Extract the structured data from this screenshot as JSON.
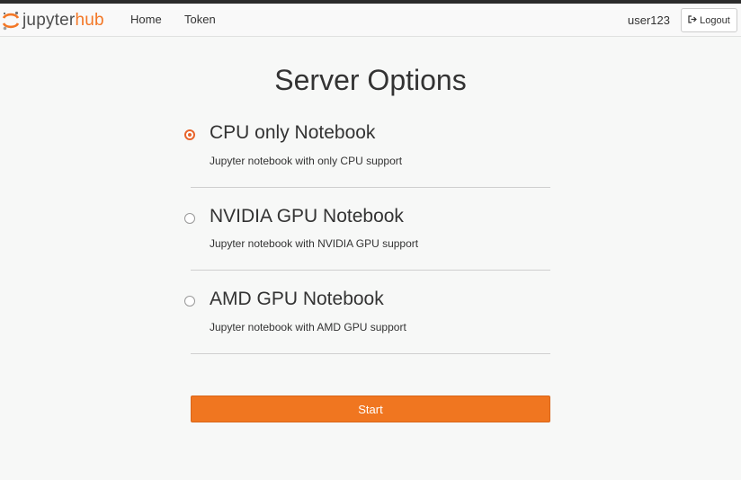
{
  "brand": {
    "part1": "jupyter",
    "part2": "hub",
    "accent": "#f37726"
  },
  "nav": {
    "home": "Home",
    "token": "Token"
  },
  "user": {
    "name": "user123",
    "logout": "Logout"
  },
  "page": {
    "title": "Server Options"
  },
  "options": [
    {
      "title": "CPU only Notebook",
      "desc": "Jupyter notebook with only CPU support",
      "checked": true
    },
    {
      "title": "NVIDIA GPU Notebook",
      "desc": "Jupyter notebook with NVIDIA GPU support",
      "checked": false
    },
    {
      "title": "AMD GPU Notebook",
      "desc": "Jupyter notebook with AMD GPU support",
      "checked": false
    }
  ],
  "start_label": "Start",
  "colors": {
    "button": "#f07620",
    "radio_selected": "#e8642b"
  }
}
